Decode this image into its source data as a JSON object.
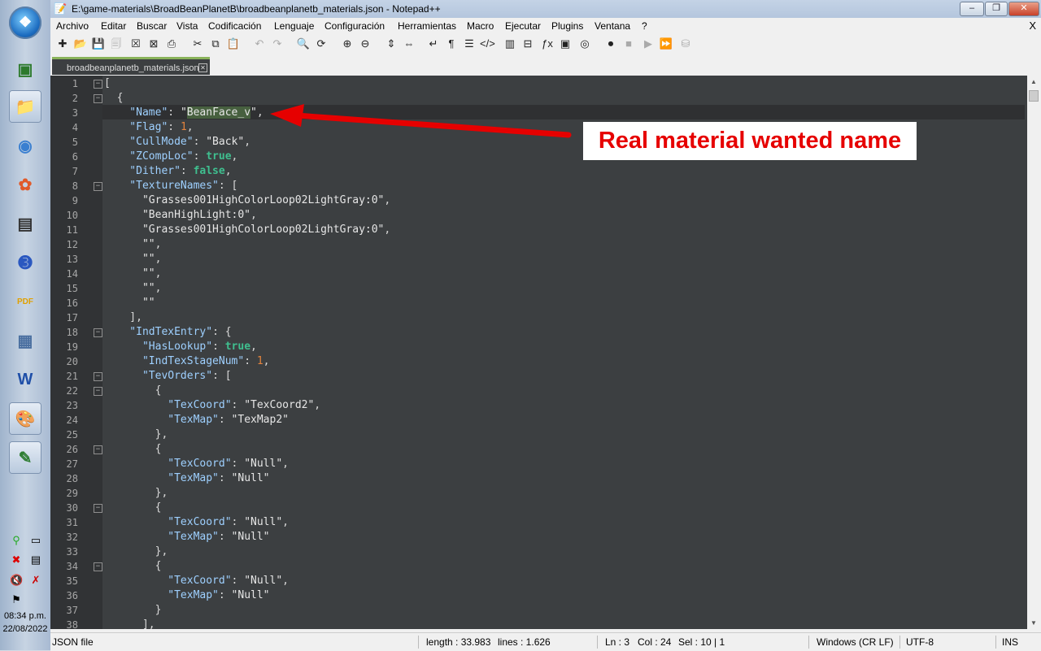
{
  "window": {
    "title": "E:\\game-materials\\BroadBeanPlanetB\\broadbeanplanetb_materials.json - Notepad++",
    "min_label": "–",
    "max_label": "❐",
    "close_label": "✕"
  },
  "menu": [
    "Archivo",
    "Editar",
    "Buscar",
    "Vista",
    "Codificación",
    "Lenguaje",
    "Configuración",
    "Herramientas",
    "Macro",
    "Ejecutar",
    "Plugins",
    "Ventana",
    "?"
  ],
  "menu_close": "X",
  "tab": {
    "label": "broadbeanplanetb_materials.json",
    "close": "✕"
  },
  "editor": {
    "line_numbers": [
      "1",
      "2",
      "3",
      "4",
      "5",
      "6",
      "7",
      "8",
      "9",
      "10",
      "11",
      "12",
      "13",
      "14",
      "15",
      "16",
      "17",
      "18",
      "19",
      "20",
      "21",
      "22",
      "23",
      "24",
      "25",
      "26",
      "27",
      "28",
      "29",
      "30",
      "31",
      "32",
      "33",
      "34",
      "35",
      "36",
      "37",
      "38"
    ],
    "lines": [
      [
        {
          "t": "[",
          "c": "p"
        }
      ],
      [
        {
          "t": "  {",
          "c": "p"
        }
      ],
      [
        {
          "t": "    \"Name\"",
          "c": "k"
        },
        {
          "t": ": ",
          "c": "p"
        },
        {
          "t": "\"",
          "c": "s"
        },
        {
          "t": "BeanFace_v",
          "c": "s sel"
        },
        {
          "t": "\"",
          "c": "s"
        },
        {
          "t": ",",
          "c": "p"
        }
      ],
      [
        {
          "t": "    \"Flag\"",
          "c": "k"
        },
        {
          "t": ": ",
          "c": "p"
        },
        {
          "t": "1",
          "c": "n"
        },
        {
          "t": ",",
          "c": "p"
        }
      ],
      [
        {
          "t": "    \"CullMode\"",
          "c": "k"
        },
        {
          "t": ": ",
          "c": "p"
        },
        {
          "t": "\"Back\"",
          "c": "s"
        },
        {
          "t": ",",
          "c": "p"
        }
      ],
      [
        {
          "t": "    \"ZCompLoc\"",
          "c": "k"
        },
        {
          "t": ": ",
          "c": "p"
        },
        {
          "t": "true",
          "c": "b"
        },
        {
          "t": ",",
          "c": "p"
        }
      ],
      [
        {
          "t": "    \"Dither\"",
          "c": "k"
        },
        {
          "t": ": ",
          "c": "p"
        },
        {
          "t": "false",
          "c": "b"
        },
        {
          "t": ",",
          "c": "p"
        }
      ],
      [
        {
          "t": "    \"TextureNames\"",
          "c": "k"
        },
        {
          "t": ": [",
          "c": "p"
        }
      ],
      [
        {
          "t": "      \"Grasses001HighColorLoop02LightGray:0\"",
          "c": "s"
        },
        {
          "t": ",",
          "c": "p"
        }
      ],
      [
        {
          "t": "      \"BeanHighLight:0\"",
          "c": "s"
        },
        {
          "t": ",",
          "c": "p"
        }
      ],
      [
        {
          "t": "      \"Grasses001HighColorLoop02LightGray:0\"",
          "c": "s"
        },
        {
          "t": ",",
          "c": "p"
        }
      ],
      [
        {
          "t": "      \"\"",
          "c": "s"
        },
        {
          "t": ",",
          "c": "p"
        }
      ],
      [
        {
          "t": "      \"\"",
          "c": "s"
        },
        {
          "t": ",",
          "c": "p"
        }
      ],
      [
        {
          "t": "      \"\"",
          "c": "s"
        },
        {
          "t": ",",
          "c": "p"
        }
      ],
      [
        {
          "t": "      \"\"",
          "c": "s"
        },
        {
          "t": ",",
          "c": "p"
        }
      ],
      [
        {
          "t": "      \"\"",
          "c": "s"
        }
      ],
      [
        {
          "t": "    ],",
          "c": "p"
        }
      ],
      [
        {
          "t": "    \"IndTexEntry\"",
          "c": "k"
        },
        {
          "t": ": {",
          "c": "p"
        }
      ],
      [
        {
          "t": "      \"HasLookup\"",
          "c": "k"
        },
        {
          "t": ": ",
          "c": "p"
        },
        {
          "t": "true",
          "c": "b"
        },
        {
          "t": ",",
          "c": "p"
        }
      ],
      [
        {
          "t": "      \"IndTexStageNum\"",
          "c": "k"
        },
        {
          "t": ": ",
          "c": "p"
        },
        {
          "t": "1",
          "c": "n"
        },
        {
          "t": ",",
          "c": "p"
        }
      ],
      [
        {
          "t": "      \"TevOrders\"",
          "c": "k"
        },
        {
          "t": ": [",
          "c": "p"
        }
      ],
      [
        {
          "t": "        {",
          "c": "p"
        }
      ],
      [
        {
          "t": "          \"TexCoord\"",
          "c": "k"
        },
        {
          "t": ": ",
          "c": "p"
        },
        {
          "t": "\"TexCoord2\"",
          "c": "s"
        },
        {
          "t": ",",
          "c": "p"
        }
      ],
      [
        {
          "t": "          \"TexMap\"",
          "c": "k"
        },
        {
          "t": ": ",
          "c": "p"
        },
        {
          "t": "\"TexMap2\"",
          "c": "s"
        }
      ],
      [
        {
          "t": "        },",
          "c": "p"
        }
      ],
      [
        {
          "t": "        {",
          "c": "p"
        }
      ],
      [
        {
          "t": "          \"TexCoord\"",
          "c": "k"
        },
        {
          "t": ": ",
          "c": "p"
        },
        {
          "t": "\"Null\"",
          "c": "s"
        },
        {
          "t": ",",
          "c": "p"
        }
      ],
      [
        {
          "t": "          \"TexMap\"",
          "c": "k"
        },
        {
          "t": ": ",
          "c": "p"
        },
        {
          "t": "\"Null\"",
          "c": "s"
        }
      ],
      [
        {
          "t": "        },",
          "c": "p"
        }
      ],
      [
        {
          "t": "        {",
          "c": "p"
        }
      ],
      [
        {
          "t": "          \"TexCoord\"",
          "c": "k"
        },
        {
          "t": ": ",
          "c": "p"
        },
        {
          "t": "\"Null\"",
          "c": "s"
        },
        {
          "t": ",",
          "c": "p"
        }
      ],
      [
        {
          "t": "          \"TexMap\"",
          "c": "k"
        },
        {
          "t": ": ",
          "c": "p"
        },
        {
          "t": "\"Null\"",
          "c": "s"
        }
      ],
      [
        {
          "t": "        },",
          "c": "p"
        }
      ],
      [
        {
          "t": "        {",
          "c": "p"
        }
      ],
      [
        {
          "t": "          \"TexCoord\"",
          "c": "k"
        },
        {
          "t": ": ",
          "c": "p"
        },
        {
          "t": "\"Null\"",
          "c": "s"
        },
        {
          "t": ",",
          "c": "p"
        }
      ],
      [
        {
          "t": "          \"TexMap\"",
          "c": "k"
        },
        {
          "t": ": ",
          "c": "p"
        },
        {
          "t": "\"Null\"",
          "c": "s"
        }
      ],
      [
        {
          "t": "        }",
          "c": "p"
        }
      ],
      [
        {
          "t": "      ],",
          "c": "p"
        }
      ]
    ],
    "fold_markers": {
      "1": "−",
      "2": "−",
      "8": "−",
      "18": "−",
      "21": "−",
      "22": "−",
      "26": "−",
      "30": "−",
      "34": "−"
    }
  },
  "annotation": {
    "text": "Real material wanted name",
    "color": "#e60000"
  },
  "status": {
    "file_type": "JSON file",
    "length": "length : 33.983",
    "lines": "lines : 1.626",
    "ln": "Ln : 3",
    "col": "Col : 24",
    "sel": "Sel : 10 | 1",
    "eol": "Windows (CR LF)",
    "encoding": "UTF-8",
    "ins": "INS"
  },
  "taskbar": {
    "clock_time": "08:34 p.m.",
    "clock_date": "22/08/2022",
    "apps": [
      "terminal-icon",
      "folder-icon",
      "chrome-icon",
      "photos-icon",
      "console-icon",
      "threed-icon",
      "pdf-icon",
      "calculator-icon",
      "word-icon",
      "paint-icon",
      "notepadpp-icon"
    ],
    "app_glyphs": [
      "▣",
      "📁",
      "◉",
      "✿",
      "▤",
      "➌",
      "PDF",
      "▦",
      "W",
      "🎨",
      "✎"
    ],
    "pdf_label": "PDF",
    "word_label": "W"
  },
  "colors": {
    "editor_bg": "#3c3f41",
    "gutter_bg": "#313335",
    "key": "#9ed0ff",
    "number": "#e3833d",
    "bool": "#3fbf8f",
    "arrow": "#e60000"
  }
}
